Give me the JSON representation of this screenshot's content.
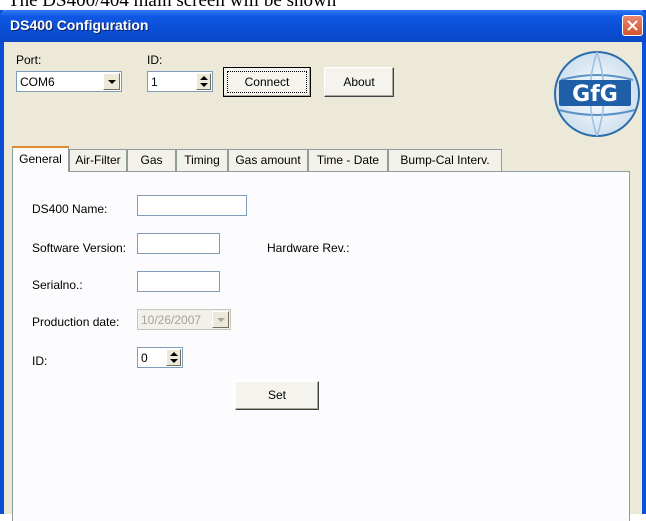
{
  "caption": "The DS400/404 main screen will be shown",
  "window": {
    "title": "DS400 Configuration"
  },
  "toolbar": {
    "port_label": "Port:",
    "port_value": "COM6",
    "id_label": "ID:",
    "id_value": "1",
    "connect_label": "Connect",
    "about_label": "About"
  },
  "logo": {
    "text": "GfG"
  },
  "tabs": [
    {
      "label": "General",
      "active": true
    },
    {
      "label": "Air-Filter"
    },
    {
      "label": "Gas"
    },
    {
      "label": "Timing"
    },
    {
      "label": "Gas amount"
    },
    {
      "label": "Time - Date"
    },
    {
      "label": "Bump-Cal Interv."
    }
  ],
  "general": {
    "name_label": "DS400 Name:",
    "name_value": "",
    "software_label": "Software Version:",
    "software_value": "",
    "hardware_label": "Hardware Rev.:",
    "serial_label": "Serialno.:",
    "serial_value": "",
    "production_label": "Production date:",
    "production_value": "10/26/2007",
    "id_label": "ID:",
    "id_value": "0",
    "set_label": "Set"
  },
  "colors": {
    "titlebar": "#0b4ed6",
    "dialog_bg": "#ece9d8",
    "active_tab_accent": "#e68b2c",
    "close_button": "#d6532f"
  }
}
